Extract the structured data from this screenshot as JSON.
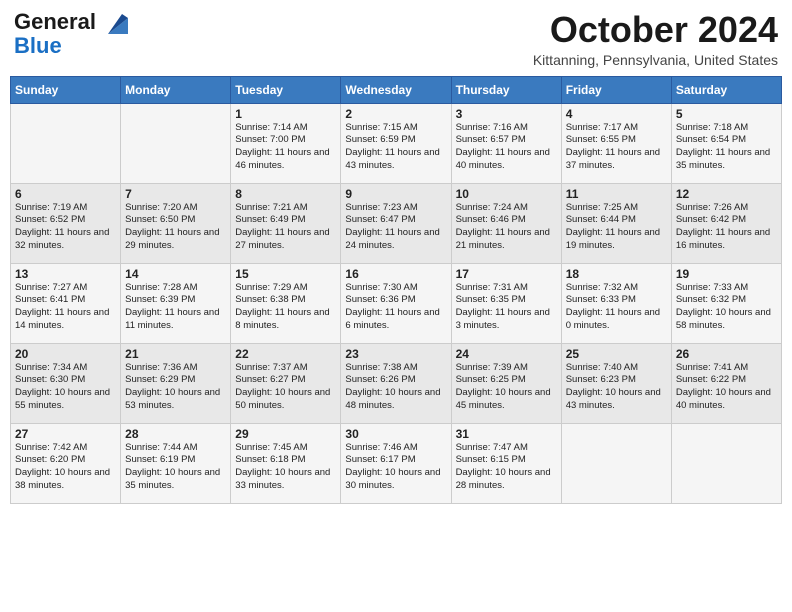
{
  "logo": {
    "general": "General",
    "blue": "Blue"
  },
  "header": {
    "month": "October 2024",
    "location": "Kittanning, Pennsylvania, United States"
  },
  "days_of_week": [
    "Sunday",
    "Monday",
    "Tuesday",
    "Wednesday",
    "Thursday",
    "Friday",
    "Saturday"
  ],
  "weeks": [
    [
      {
        "day": null
      },
      {
        "day": null
      },
      {
        "day": "1",
        "sunrise": "7:14 AM",
        "sunset": "7:00 PM",
        "daylight": "11 hours and 46 minutes."
      },
      {
        "day": "2",
        "sunrise": "7:15 AM",
        "sunset": "6:59 PM",
        "daylight": "11 hours and 43 minutes."
      },
      {
        "day": "3",
        "sunrise": "7:16 AM",
        "sunset": "6:57 PM",
        "daylight": "11 hours and 40 minutes."
      },
      {
        "day": "4",
        "sunrise": "7:17 AM",
        "sunset": "6:55 PM",
        "daylight": "11 hours and 37 minutes."
      },
      {
        "day": "5",
        "sunrise": "7:18 AM",
        "sunset": "6:54 PM",
        "daylight": "11 hours and 35 minutes."
      }
    ],
    [
      {
        "day": "6",
        "sunrise": "7:19 AM",
        "sunset": "6:52 PM",
        "daylight": "11 hours and 32 minutes."
      },
      {
        "day": "7",
        "sunrise": "7:20 AM",
        "sunset": "6:50 PM",
        "daylight": "11 hours and 29 minutes."
      },
      {
        "day": "8",
        "sunrise": "7:21 AM",
        "sunset": "6:49 PM",
        "daylight": "11 hours and 27 minutes."
      },
      {
        "day": "9",
        "sunrise": "7:23 AM",
        "sunset": "6:47 PM",
        "daylight": "11 hours and 24 minutes."
      },
      {
        "day": "10",
        "sunrise": "7:24 AM",
        "sunset": "6:46 PM",
        "daylight": "11 hours and 21 minutes."
      },
      {
        "day": "11",
        "sunrise": "7:25 AM",
        "sunset": "6:44 PM",
        "daylight": "11 hours and 19 minutes."
      },
      {
        "day": "12",
        "sunrise": "7:26 AM",
        "sunset": "6:42 PM",
        "daylight": "11 hours and 16 minutes."
      }
    ],
    [
      {
        "day": "13",
        "sunrise": "7:27 AM",
        "sunset": "6:41 PM",
        "daylight": "11 hours and 14 minutes."
      },
      {
        "day": "14",
        "sunrise": "7:28 AM",
        "sunset": "6:39 PM",
        "daylight": "11 hours and 11 minutes."
      },
      {
        "day": "15",
        "sunrise": "7:29 AM",
        "sunset": "6:38 PM",
        "daylight": "11 hours and 8 minutes."
      },
      {
        "day": "16",
        "sunrise": "7:30 AM",
        "sunset": "6:36 PM",
        "daylight": "11 hours and 6 minutes."
      },
      {
        "day": "17",
        "sunrise": "7:31 AM",
        "sunset": "6:35 PM",
        "daylight": "11 hours and 3 minutes."
      },
      {
        "day": "18",
        "sunrise": "7:32 AM",
        "sunset": "6:33 PM",
        "daylight": "11 hours and 0 minutes."
      },
      {
        "day": "19",
        "sunrise": "7:33 AM",
        "sunset": "6:32 PM",
        "daylight": "10 hours and 58 minutes."
      }
    ],
    [
      {
        "day": "20",
        "sunrise": "7:34 AM",
        "sunset": "6:30 PM",
        "daylight": "10 hours and 55 minutes."
      },
      {
        "day": "21",
        "sunrise": "7:36 AM",
        "sunset": "6:29 PM",
        "daylight": "10 hours and 53 minutes."
      },
      {
        "day": "22",
        "sunrise": "7:37 AM",
        "sunset": "6:27 PM",
        "daylight": "10 hours and 50 minutes."
      },
      {
        "day": "23",
        "sunrise": "7:38 AM",
        "sunset": "6:26 PM",
        "daylight": "10 hours and 48 minutes."
      },
      {
        "day": "24",
        "sunrise": "7:39 AM",
        "sunset": "6:25 PM",
        "daylight": "10 hours and 45 minutes."
      },
      {
        "day": "25",
        "sunrise": "7:40 AM",
        "sunset": "6:23 PM",
        "daylight": "10 hours and 43 minutes."
      },
      {
        "day": "26",
        "sunrise": "7:41 AM",
        "sunset": "6:22 PM",
        "daylight": "10 hours and 40 minutes."
      }
    ],
    [
      {
        "day": "27",
        "sunrise": "7:42 AM",
        "sunset": "6:20 PM",
        "daylight": "10 hours and 38 minutes."
      },
      {
        "day": "28",
        "sunrise": "7:44 AM",
        "sunset": "6:19 PM",
        "daylight": "10 hours and 35 minutes."
      },
      {
        "day": "29",
        "sunrise": "7:45 AM",
        "sunset": "6:18 PM",
        "daylight": "10 hours and 33 minutes."
      },
      {
        "day": "30",
        "sunrise": "7:46 AM",
        "sunset": "6:17 PM",
        "daylight": "10 hours and 30 minutes."
      },
      {
        "day": "31",
        "sunrise": "7:47 AM",
        "sunset": "6:15 PM",
        "daylight": "10 hours and 28 minutes."
      },
      {
        "day": null
      },
      {
        "day": null
      }
    ]
  ]
}
